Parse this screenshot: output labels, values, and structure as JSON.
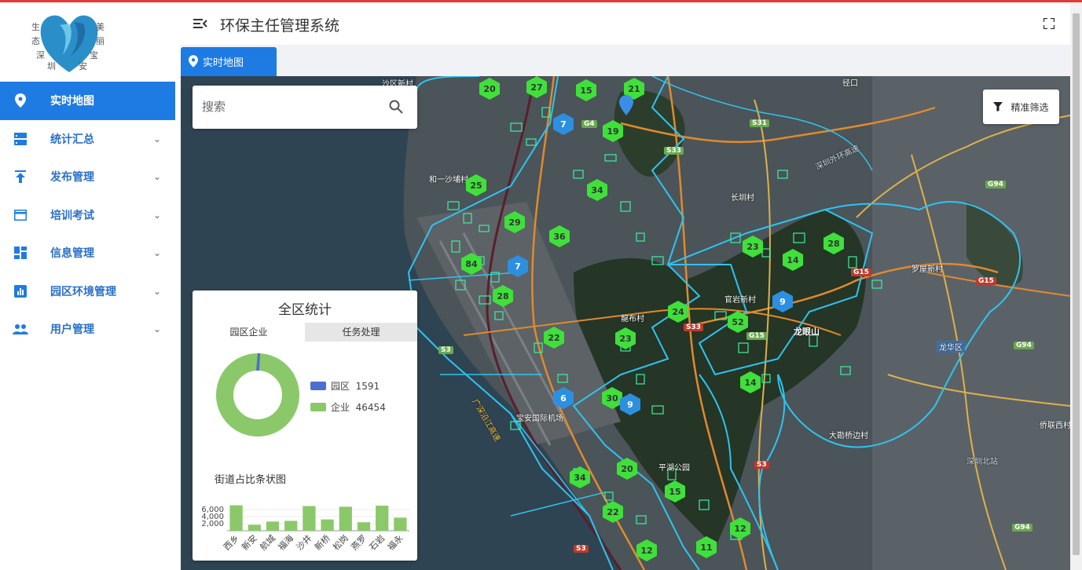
{
  "app": {
    "title": "环保主任管理系统"
  },
  "logo": {
    "chars": [
      "生",
      "态",
      "深",
      "圳",
      "美",
      "丽",
      "宝",
      "安"
    ]
  },
  "sidebar": {
    "items": [
      {
        "label": "实时地图",
        "icon": "map-pin-icon",
        "active": true
      },
      {
        "label": "统计汇总",
        "icon": "dns-icon"
      },
      {
        "label": "发布管理",
        "icon": "upload-icon"
      },
      {
        "label": "培训考试",
        "icon": "card-icon"
      },
      {
        "label": "信息管理",
        "icon": "dashboard-icon"
      },
      {
        "label": "园区环境管理",
        "icon": "bar-chart-icon"
      },
      {
        "label": "用户管理",
        "icon": "people-icon"
      }
    ]
  },
  "tabs": [
    {
      "label": "实时地图",
      "icon": "map-pin-icon"
    }
  ],
  "search": {
    "placeholder": "搜索"
  },
  "filter": {
    "label": "精准筛选"
  },
  "stats": {
    "title": "全区统计",
    "tabs": [
      "园区企业",
      "任务处理"
    ],
    "legend": [
      {
        "label": "园区",
        "value": "1591",
        "color": "#4a6fd1"
      },
      {
        "label": "企业",
        "value": "46454",
        "color": "#8bc86a"
      }
    ],
    "bar_title": "街道占比条状图"
  },
  "chart_data": {
    "type": "bar",
    "title": "街道占比条状图",
    "categories": [
      "西乡",
      "新安",
      "航城",
      "福海",
      "沙井",
      "新桥",
      "松岗",
      "燕罗",
      "石岩",
      "福永"
    ],
    "values": [
      7200,
      1700,
      2600,
      2800,
      7000,
      3200,
      6800,
      2400,
      7100,
      3700
    ],
    "yticks": [
      "6,000",
      "4,000",
      "2,000"
    ],
    "ylim": [
      0,
      8000
    ],
    "color": "#8bc86a"
  },
  "map": {
    "labels": [
      {
        "text": "沙区新村"
      },
      {
        "text": "径口"
      },
      {
        "text": "和一沙埔村"
      },
      {
        "text": "长圳村"
      },
      {
        "text": "罗屋新村"
      },
      {
        "text": "官岩新村"
      },
      {
        "text": "龙眼山"
      },
      {
        "text": "龙华区"
      },
      {
        "text": "大勘桥边村"
      },
      {
        "text": "侨联西村"
      },
      {
        "text": "深圳北站"
      },
      {
        "text": "宝安国际机场"
      },
      {
        "text": "龍布村"
      },
      {
        "text": "平湖公园"
      },
      {
        "text": "广深沿江高速"
      },
      {
        "text": "深圳外环高速"
      }
    ],
    "roads": [
      "G4",
      "S31",
      "S33",
      "G94",
      "G15",
      "S3",
      "G15",
      "S33",
      "G15",
      "S3",
      "S3",
      "G94",
      "G94"
    ],
    "clusters": [
      {
        "n": "20",
        "c": "green"
      },
      {
        "n": "27",
        "c": "green"
      },
      {
        "n": "15",
        "c": "green"
      },
      {
        "n": "21",
        "c": "green"
      },
      {
        "n": "7",
        "c": "blue"
      },
      {
        "n": "19",
        "c": "green"
      },
      {
        "n": "25",
        "c": "green"
      },
      {
        "n": "34",
        "c": "green"
      },
      {
        "n": "29",
        "c": "green"
      },
      {
        "n": "36",
        "c": "green"
      },
      {
        "n": "84",
        "c": "green"
      },
      {
        "n": "7",
        "c": "blue"
      },
      {
        "n": "28",
        "c": "green"
      },
      {
        "n": "23",
        "c": "green"
      },
      {
        "n": "14",
        "c": "green"
      },
      {
        "n": "28",
        "c": "green"
      },
      {
        "n": "9",
        "c": "blue"
      },
      {
        "n": "24",
        "c": "green"
      },
      {
        "n": "52",
        "c": "green"
      },
      {
        "n": "22",
        "c": "green"
      },
      {
        "n": "23",
        "c": "green"
      },
      {
        "n": "14",
        "c": "green"
      },
      {
        "n": "6",
        "c": "blue"
      },
      {
        "n": "30",
        "c": "green"
      },
      {
        "n": "9",
        "c": "blue"
      },
      {
        "n": "20",
        "c": "green"
      },
      {
        "n": "34",
        "c": "green"
      },
      {
        "n": "15",
        "c": "green"
      },
      {
        "n": "22",
        "c": "green"
      },
      {
        "n": "12",
        "c": "green"
      },
      {
        "n": "11",
        "c": "green"
      },
      {
        "n": "12",
        "c": "green"
      }
    ]
  }
}
